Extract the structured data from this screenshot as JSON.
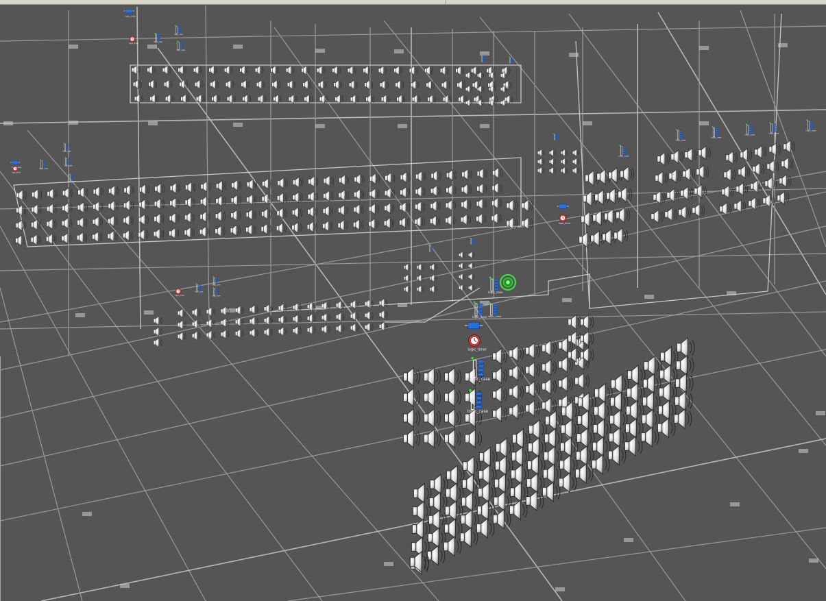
{
  "viewport": {
    "background": "#555555",
    "grid_color": "#9a9a9a",
    "selection_box_color": "#c8c8c8"
  },
  "icons": {
    "speaker": "speaker-icon",
    "logic_case": "logic-case-icon",
    "logic_timer": "logic-timer-icon",
    "logic_relay": "logic-relay-icon",
    "info_target": "info-target-icon"
  },
  "colors": {
    "logic_blue": "#2a6fe0",
    "logic_green": "#3ce03c",
    "timer_red": "#e04040",
    "speaker_white": "#f2f2f2"
  },
  "labels": {
    "logic_timer": "logic_timer",
    "logic_case": "logic_case",
    "logic_relay": "logic_relay"
  }
}
